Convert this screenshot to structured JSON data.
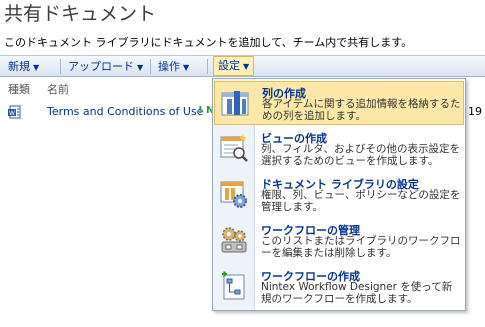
{
  "page": {
    "title": "共有ドキュメント",
    "description": "このドキュメント ライブラリにドキュメントを追加して、チーム内で共有します。"
  },
  "toolbar": {
    "new_label": "新規",
    "upload_label": "アップロード",
    "actions_label": "操作",
    "settings_label": "設定"
  },
  "list": {
    "columns": [
      "種類",
      "名前"
    ],
    "rows": [
      {
        "name": "Terms and Conditions of Use",
        "badge": "! N",
        "trailing": "19"
      }
    ]
  },
  "settings_menu": {
    "items": [
      {
        "title": "列の作成",
        "description": "各アイテムに関する追加情報を格納するための列を追加します。",
        "icon": "create-column-icon"
      },
      {
        "title": "ビューの作成",
        "description": "列、フィルタ、およびその他の表示設定を選択するためのビューを作成します。",
        "icon": "create-view-icon"
      },
      {
        "title": "ドキュメント ライブラリの設定",
        "description": "権限、列、ビュー、ポリシーなどの設定を管理します。",
        "icon": "library-settings-icon"
      },
      {
        "title": "ワークフローの管理",
        "description": "このリストまたはライブラリのワークフローを編集または削除します。",
        "icon": "manage-workflows-icon"
      },
      {
        "title": "ワークフローの作成",
        "description": "Nintex Workflow Designer を使って新規のワークフローを作成します。",
        "icon": "create-workflow-icon"
      }
    ]
  },
  "colors": {
    "link": "#003399",
    "highlight": "#fce9a7",
    "toolbar_bg": "#d9e3f0"
  }
}
